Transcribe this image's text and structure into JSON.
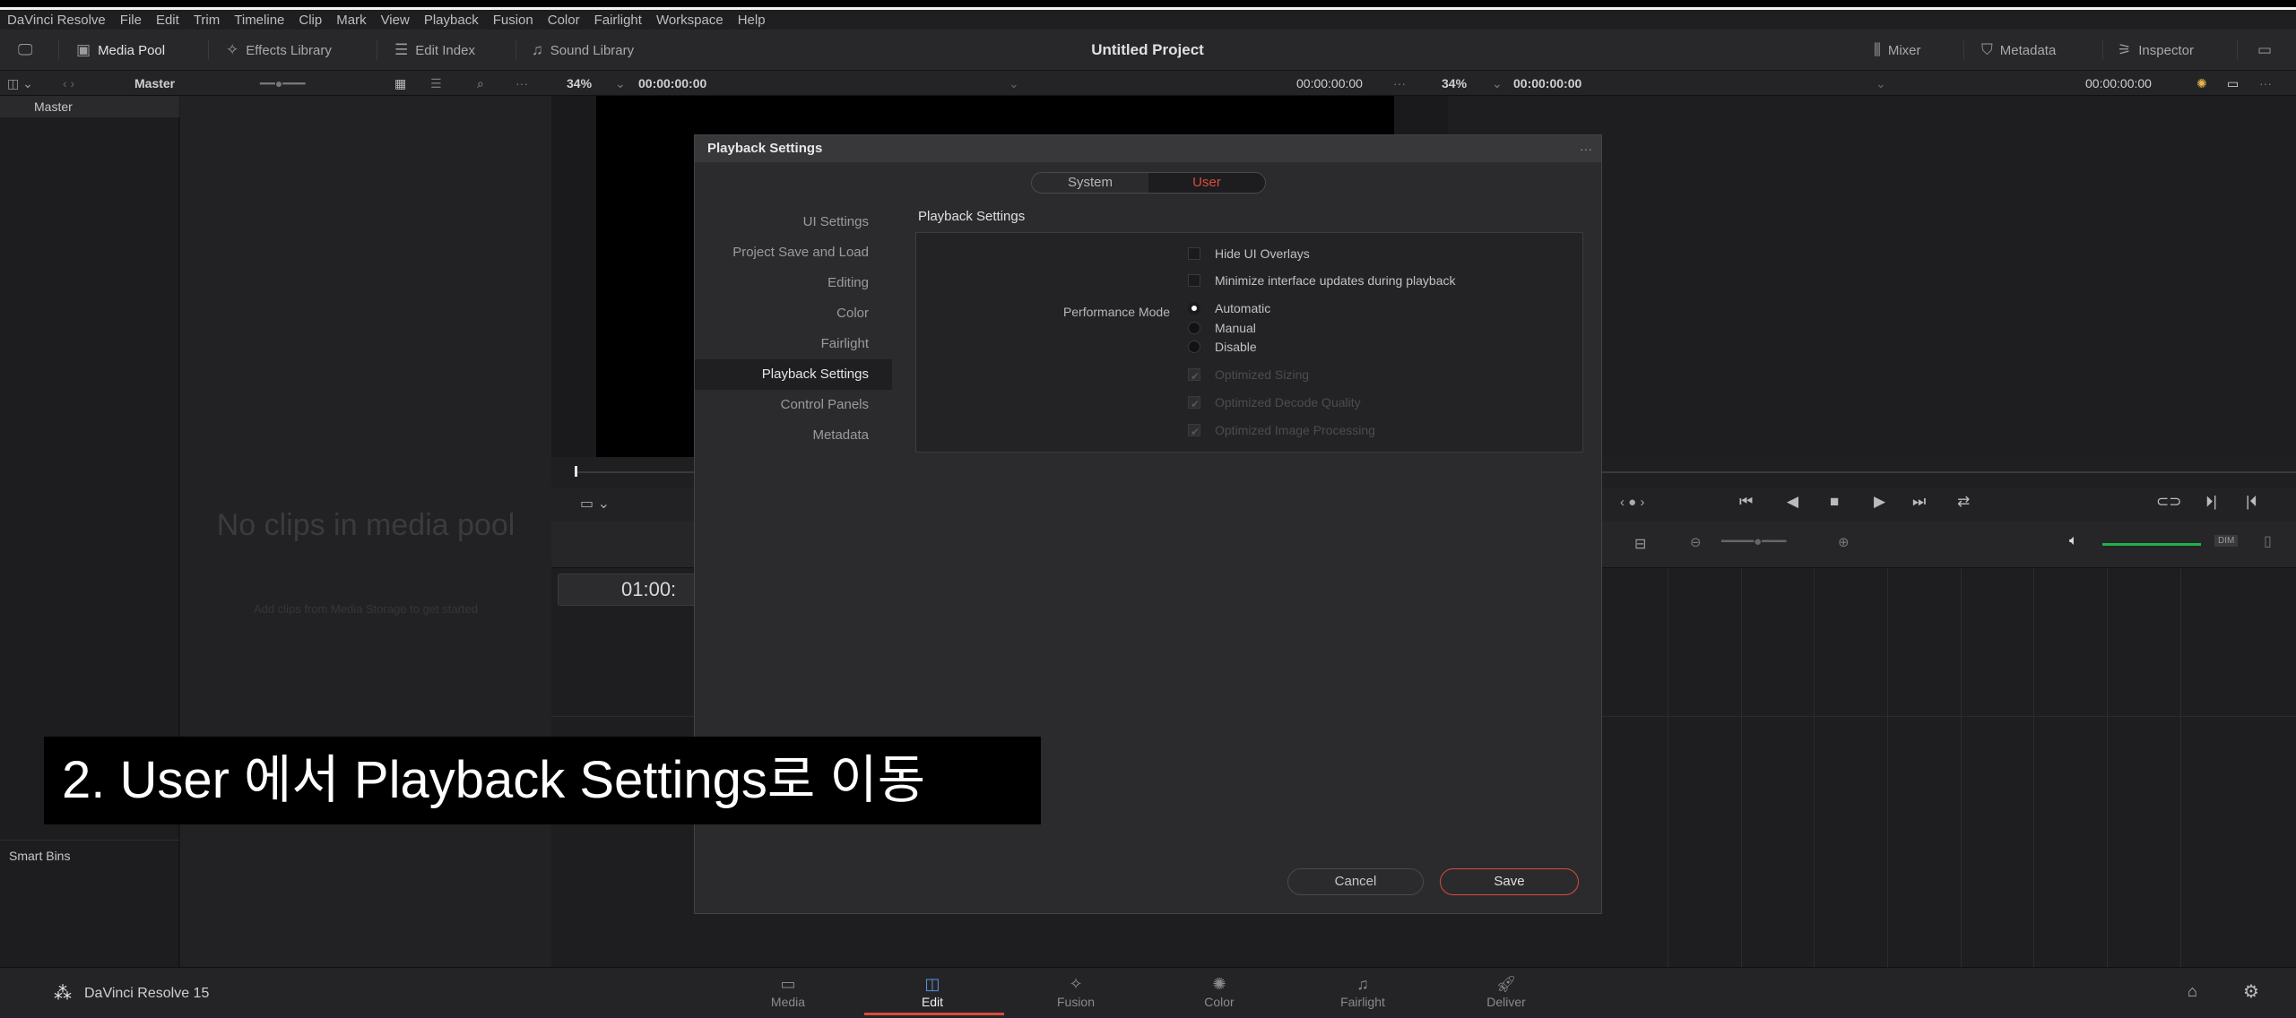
{
  "menu": [
    "DaVinci Resolve",
    "File",
    "Edit",
    "Trim",
    "Timeline",
    "Clip",
    "Mark",
    "View",
    "Playback",
    "Fusion",
    "Color",
    "Fairlight",
    "Workspace",
    "Help"
  ],
  "toolbar": {
    "media_pool": "Media Pool",
    "effects_library": "Effects Library",
    "edit_index": "Edit Index",
    "sound_library": "Sound Library",
    "project_title": "Untitled Project",
    "mixer": "Mixer",
    "metadata": "Metadata",
    "inspector": "Inspector"
  },
  "subbar": {
    "bin": "Master",
    "zoom1": "34%",
    "tc1": "00:00:00:00",
    "tc2": "00:00:00:00",
    "zoom2": "34%",
    "tc3": "00:00:00:00",
    "tc4": "00:00:00:00"
  },
  "media": {
    "master_header": "Master",
    "empty_title": "No clips in media pool",
    "empty_hint": "Add clips from Media Storage to get started",
    "smart_bins": "Smart Bins"
  },
  "timeline": {
    "timecode": "01:00:"
  },
  "dialog": {
    "title": "Playback Settings",
    "tabs": {
      "system": "System",
      "user": "User"
    },
    "nav": [
      "UI Settings",
      "Project Save and Load",
      "Editing",
      "Color",
      "Fairlight",
      "Playback Settings",
      "Control Panels",
      "Metadata"
    ],
    "section_title": "Playback Settings",
    "hide_ui_overlays": "Hide UI Overlays",
    "minimize_updates": "Minimize interface updates during playback",
    "performance_mode_label": "Performance Mode",
    "modes": [
      "Automatic",
      "Manual",
      "Disable"
    ],
    "optimized_sizing": "Optimized Sizing",
    "optimized_decode": "Optimized Decode Quality",
    "optimized_image": "Optimized Image Processing",
    "cancel": "Cancel",
    "save": "Save"
  },
  "caption": "2. User 에서 Playback Settings로 이동",
  "bottom": {
    "app_name": "DaVinci Resolve 15",
    "pages": [
      "Media",
      "Edit",
      "Fusion",
      "Color",
      "Fairlight",
      "Deliver"
    ]
  },
  "colors": {
    "accent": "#d94b3d",
    "background": "#1b1b1d",
    "dialog": "#2b2b2d"
  }
}
